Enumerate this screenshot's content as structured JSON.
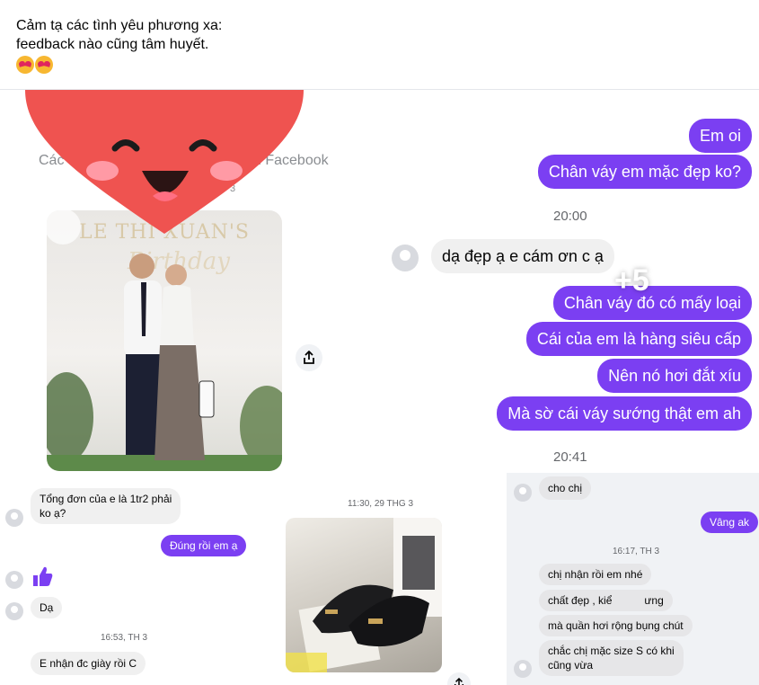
{
  "post": {
    "line1": "Cảm tạ các tình yêu phương xa:",
    "line2": "feedback nào cũng tâm huyết.",
    "emojis": [
      "smiling-face-with-hearts",
      "smiling-face-with-hearts"
    ]
  },
  "tile1": {
    "faded_left": "Các",
    "faded_right": "n Facebook",
    "faded_time": "3",
    "photo_banner": "LE THI XUAN'S",
    "photo_script": "Birthday",
    "share_icon": "share-icon"
  },
  "tile2": {
    "messages": [
      {
        "text": "Em oi"
      },
      {
        "text": "Chân váy em mặc đẹp ko?"
      }
    ],
    "time1": "20:00",
    "reply": "dạ đẹp ạ e cám ơn c ạ",
    "messages2": [
      {
        "text": "Chân váy đó có mấy loại"
      },
      {
        "text": "Cái của em là hàng siêu cấp"
      },
      {
        "text": "Nên nó hơi đắt xíu"
      },
      {
        "text": "Mà sờ cái váy sướng thật em ah"
      }
    ],
    "time2": "20:41"
  },
  "tile3": {
    "msg1": "Tổng đơn  của e là 1tr2 phải",
    "msg1b": "ko ạ?",
    "msg2": "Đúng rồi em ạ",
    "msg3": "Dạ",
    "time": "16:53, TH 3",
    "msg4": "E nhận đc giày rồi C"
  },
  "tile4": {
    "time": "11:30, 29 THG 3"
  },
  "tile5": {
    "msg1": "cho chị",
    "msg2": "Vâng ak",
    "time": "16:17, TH 3",
    "msg3": "chị nhận rồi em nhé",
    "msg4": "chất đẹp , kiể",
    "msg4b": "ưng",
    "msg5": "mà quần hơi rộng bụng chút",
    "msg6a": "chắc chị mặc size S có khi",
    "msg6b": "cũng vừa",
    "overlay": "+5"
  },
  "colors": {
    "outgoing": "#7b3ff2",
    "incoming": "#f0f0f0",
    "heart": "#ef5350"
  }
}
